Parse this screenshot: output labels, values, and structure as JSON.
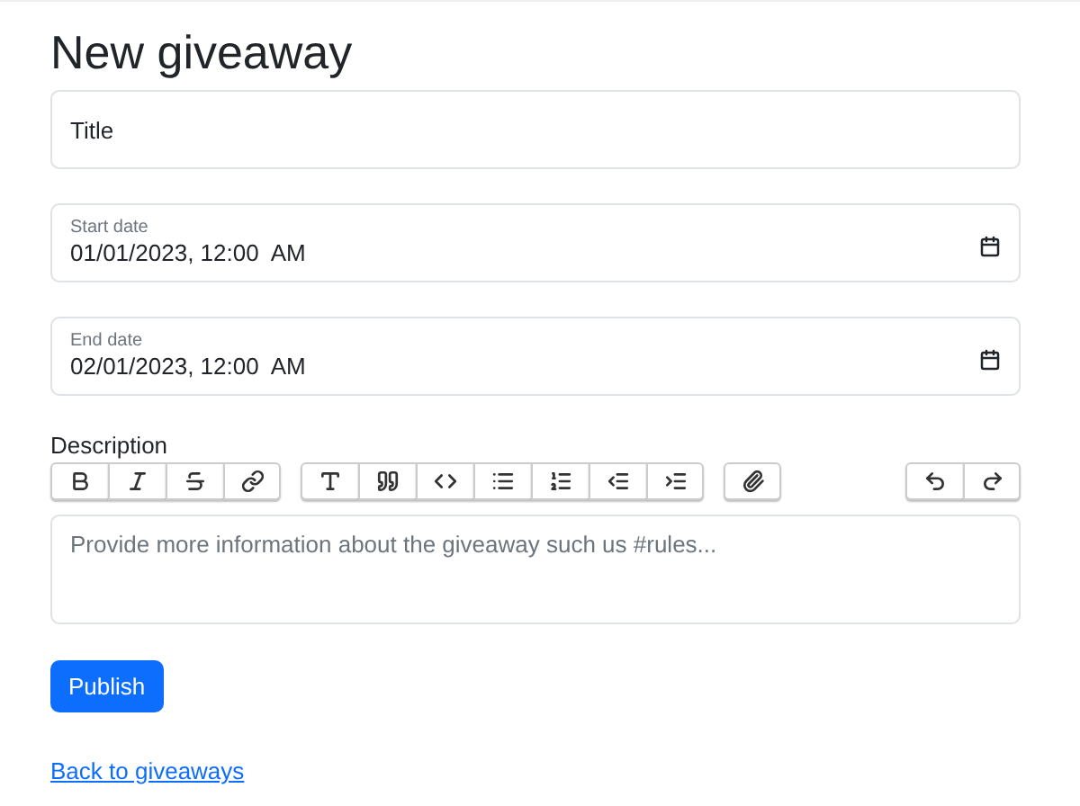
{
  "heading": "New giveaway",
  "title_field": {
    "placeholder": "Title"
  },
  "date_fields": [
    {
      "label": "Start date",
      "value": "01/01/2023, 12:00  AM"
    },
    {
      "label": "End date",
      "value": "02/01/2023, 12:00  AM"
    }
  ],
  "description": {
    "label": "Description",
    "toolbar_groups": [
      {
        "buttons": [
          {
            "kind": "bold"
          },
          {
            "kind": "italic"
          },
          {
            "kind": "strike"
          },
          {
            "kind": "link"
          }
        ]
      },
      {
        "buttons": [
          {
            "kind": "heading"
          },
          {
            "kind": "quote"
          },
          {
            "kind": "code"
          },
          {
            "kind": "bullets"
          },
          {
            "kind": "numbers"
          },
          {
            "kind": "outdent"
          },
          {
            "kind": "indent"
          }
        ]
      },
      {
        "buttons": [
          {
            "kind": "attach"
          }
        ]
      }
    ],
    "toolbar_right_groups": [
      {
        "buttons": [
          {
            "kind": "undo"
          },
          {
            "kind": "redo"
          }
        ]
      }
    ],
    "placeholder": "Provide more information about the giveaway such us #rules..."
  },
  "publish_button": "Publish",
  "back_link": "Back to giveaways"
}
